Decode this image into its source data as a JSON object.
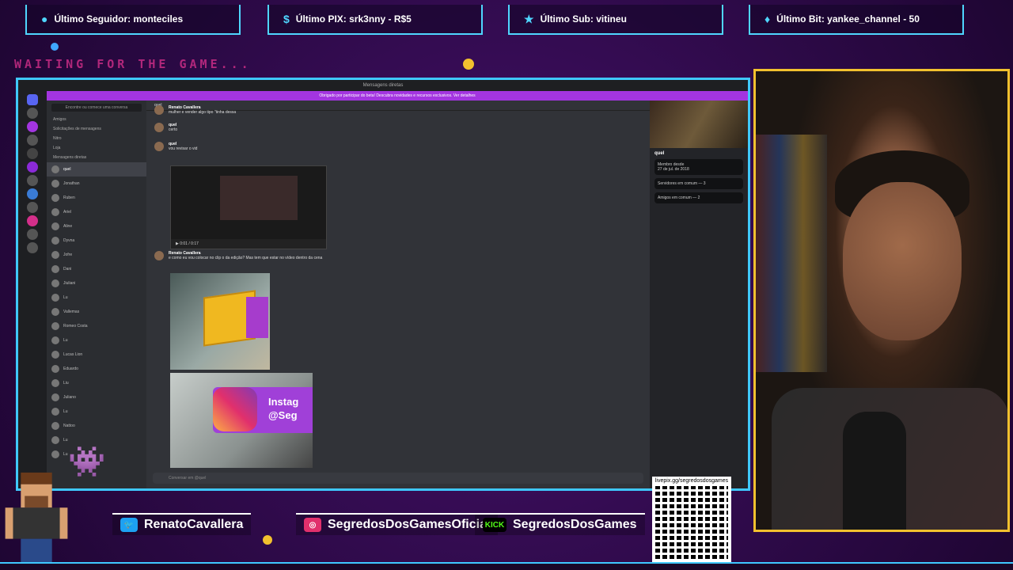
{
  "alerts": [
    {
      "icon": "user-icon",
      "text": "Último Seguidor: monteciles"
    },
    {
      "icon": "pix-icon",
      "text": "Último PIX: srk3nny - R$5"
    },
    {
      "icon": "star-icon",
      "text": "Último Sub: vitineu"
    },
    {
      "icon": "diamond-icon",
      "text": "Último Bit: yankee_channel - 50"
    }
  ],
  "waiting_text": "WAITING FOR THE GAME...",
  "discord": {
    "titlebar": "Mensagens diretas",
    "banner": "Obrigado por participar do beta! Descubra novidades e recursos exclusivos. Ver detalhes",
    "dm_search": "Encontre ou comece uma conversa",
    "nav": [
      "Amigos",
      "Solicitações de mensagens",
      "Nitro",
      "Loja"
    ],
    "dm_header": "Mensagens diretas",
    "dm_list": [
      "quel",
      "Jonathan",
      "Ruben",
      "Ariel",
      "Aline",
      "Dyvna",
      "Jofre",
      "Dani",
      "Jiuliani",
      "Lu",
      "Vallemas",
      "Romeo Costa",
      "Lu",
      "Lucas Lion",
      "Eduardo",
      "Liu",
      "Juliano",
      "Lu",
      "Nattoo",
      "Lu",
      "Lu"
    ],
    "chat_channel": "quel",
    "messages": [
      {
        "name": "Renato Cavallera",
        "text": "mulher e vender algo tipo \"tinha dessa"
      },
      {
        "name": "quel",
        "text": "certo"
      },
      {
        "name": "quel",
        "text": "vou revisar o vid"
      },
      {
        "name": "Renato Cavallera",
        "text": "e como eu vou colocar no clip o da edição? Mas tem que estar no vídeo dentro da cena"
      }
    ],
    "video_time": "0:01 / 0:17",
    "instagram_text": "Instag @Seg",
    "chat_input_placeholder": "Conversar em @quel",
    "profile": {
      "name": "quel",
      "member_since_label": "Membro desde",
      "member_since": "27 de jul. de 2018",
      "servers_common": "Servidores em comum — 3",
      "friends_common": "Amigos em comum — 2"
    }
  },
  "socials": [
    {
      "icon": "twitter-icon",
      "handle": "RenatoCavallera",
      "color": "#1da1f2"
    },
    {
      "icon": "instagram-icon",
      "handle": "SegredosDosGamesOficial",
      "color": "#e1306c"
    },
    {
      "icon": "kick-icon",
      "handle": "SegredosDosGames",
      "color": "#53fc18",
      "badge": "KICK"
    }
  ],
  "qr_label": "livepix.gg/segredosdosgames",
  "colors": {
    "frame": "#3fc8ff",
    "cam_border": "#f2c12e",
    "accent_pink": "#d42f8a"
  }
}
